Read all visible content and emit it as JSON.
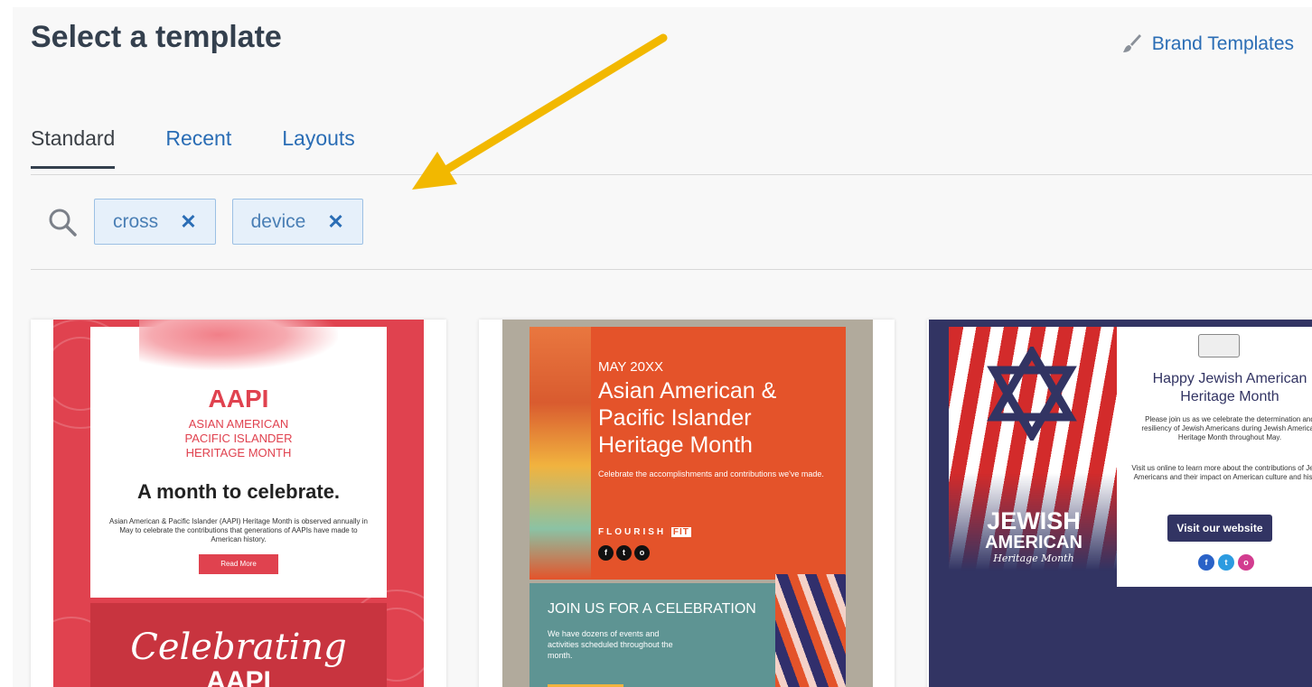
{
  "header": {
    "title": "Select a template",
    "brand_templates_label": "Brand Templates",
    "brand_icon": "paintbrush-icon"
  },
  "tabs": [
    {
      "label": "Standard",
      "active": true
    },
    {
      "label": "Recent",
      "active": false
    },
    {
      "label": "Layouts",
      "active": false
    }
  ],
  "search": {
    "icon": "search-icon",
    "chips": [
      {
        "label": "cross",
        "remove_glyph": "✕"
      },
      {
        "label": "device",
        "remove_glyph": "✕"
      }
    ]
  },
  "colors": {
    "accent": "#2a6db5",
    "title": "#34404e",
    "chip_bg": "#e6f0fa",
    "annotation_arrow": "#f2b800"
  },
  "cards": [
    {
      "title": "AAPI",
      "subtitle_lines": [
        "ASIAN AMERICAN",
        "PACIFIC ISLANDER",
        "HERITAGE MONTH"
      ],
      "headline": "A month to celebrate.",
      "body": "Asian American & Pacific Islander (AAPI) Heritage Month is observed annually in May to celebrate the contributions that generations of AAPIs have made to American history.",
      "button": "Read More",
      "script_text": "Celebrating",
      "bottom_text": "AAPI"
    },
    {
      "month": "MAY 20XX",
      "heading_lines": [
        "Asian American &",
        "Pacific Islander",
        "Heritage Month"
      ],
      "description": "Celebrate the accomplishments and contributions we've made.",
      "logo_text": "FLOURISH",
      "logo_badge": "FIT",
      "socials": [
        "f",
        "t",
        "o"
      ],
      "join_title": "JOIN US FOR A CELEBRATION",
      "join_desc": "We have dozens of events and activities scheduled throughout the month."
    },
    {
      "left_title_lines": [
        "JEWISH",
        "AMERICAN"
      ],
      "left_subtitle": "Heritage Month",
      "heading_lines": [
        "Happy Jewish American",
        "Heritage Month"
      ],
      "para1": "Please join us as we celebrate the determination and resiliency of Jewish Americans during Jewish American Heritage Month throughout May.",
      "para2": "Visit us online to learn more about the contributions of Jewish Americans and their impact on American culture and history.",
      "button": "Visit our website",
      "socials": [
        "f",
        "t",
        "o"
      ]
    }
  ]
}
